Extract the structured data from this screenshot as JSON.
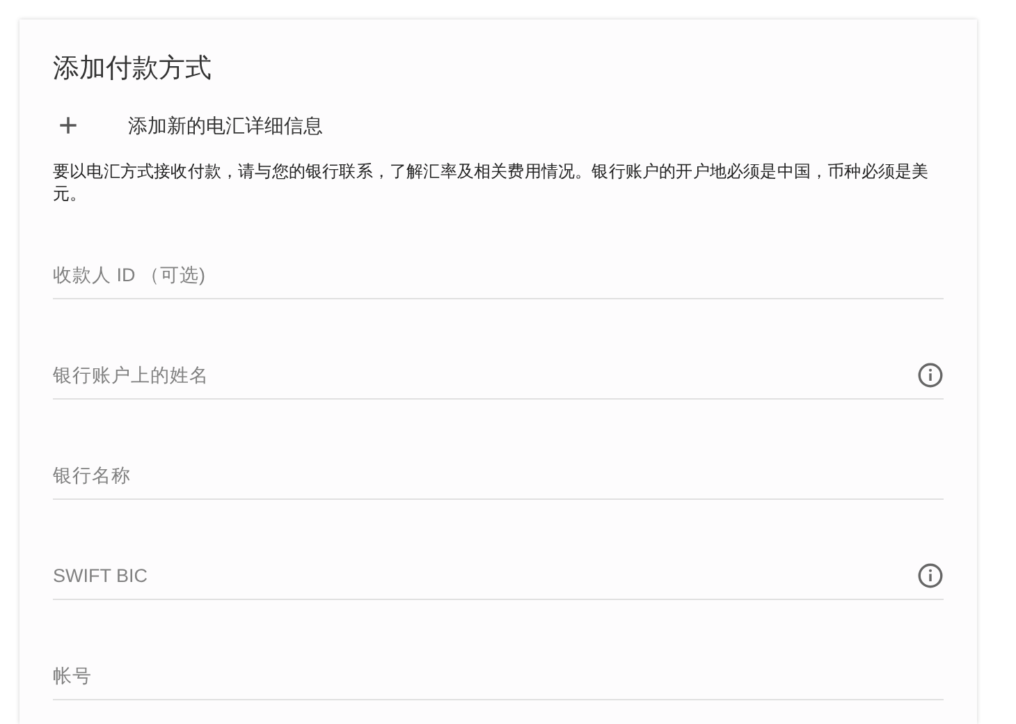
{
  "card": {
    "title": "添加付款方式",
    "add_link": {
      "icon": "+",
      "label": "添加新的电汇详细信息"
    },
    "description": "要以电汇方式接收付款，请与您的银行联系，了解汇率及相关费用情况。银行账户的开户地必须是中国，币种必须是美元。",
    "fields": [
      {
        "placeholder": "收款人 ID （可选)",
        "info": false
      },
      {
        "placeholder": "银行账户上的姓名",
        "info": true
      },
      {
        "placeholder": "银行名称",
        "info": false
      },
      {
        "placeholder": "SWIFT BIC",
        "info": true
      },
      {
        "placeholder": "帐号",
        "info": false
      }
    ]
  }
}
